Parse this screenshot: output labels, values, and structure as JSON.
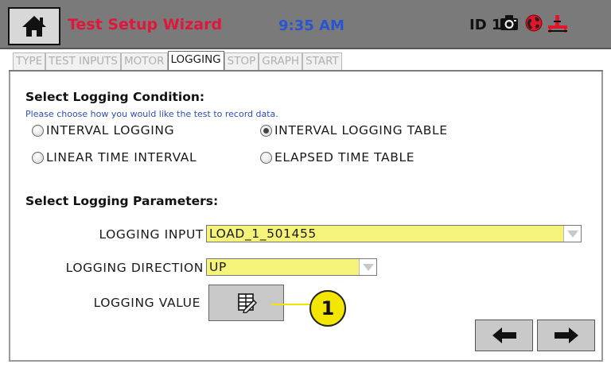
{
  "header": {
    "title": "Test Setup Wizard",
    "time": "9:35 AM",
    "device_id": "ID 1",
    "icons": [
      "home-icon",
      "camera-icon",
      "network-globe-icon",
      "frame-status-icon"
    ],
    "colors": {
      "title": "#e0173a",
      "time": "#2a55d2",
      "bar": "#7a7a7a"
    }
  },
  "tabs": [
    {
      "label": "TYPE",
      "active": false
    },
    {
      "label": "TEST INPUTS",
      "active": false
    },
    {
      "label": "MOTOR",
      "active": false
    },
    {
      "label": "LOGGING",
      "active": true
    },
    {
      "label": "STOP",
      "active": false
    },
    {
      "label": "GRAPH",
      "active": false
    },
    {
      "label": "START",
      "active": false
    }
  ],
  "logging_condition": {
    "heading": "Select Logging Condition:",
    "hint": "Please choose how you would like the test to record data.",
    "options": [
      {
        "label": "INTERVAL LOGGING",
        "selected": false
      },
      {
        "label": "INTERVAL LOGGING TABLE",
        "selected": true
      },
      {
        "label": "LINEAR TIME INTERVAL",
        "selected": false
      },
      {
        "label": "ELAPSED TIME TABLE",
        "selected": false
      }
    ]
  },
  "logging_parameters": {
    "heading": "Select Logging Parameters:",
    "input_label": "LOGGING INPUT",
    "input_value": "LOAD_1_501455",
    "direction_label": "LOGGING DIRECTION",
    "direction_value": "UP",
    "value_label": "LOGGING VALUE",
    "value_button_icon": "table-edit-icon",
    "field_color": "#f5f37a"
  },
  "callout": {
    "number": "1",
    "color": "#f5e600"
  },
  "navigation": {
    "back_icon": "arrow-left-icon",
    "next_icon": "arrow-right-icon"
  }
}
